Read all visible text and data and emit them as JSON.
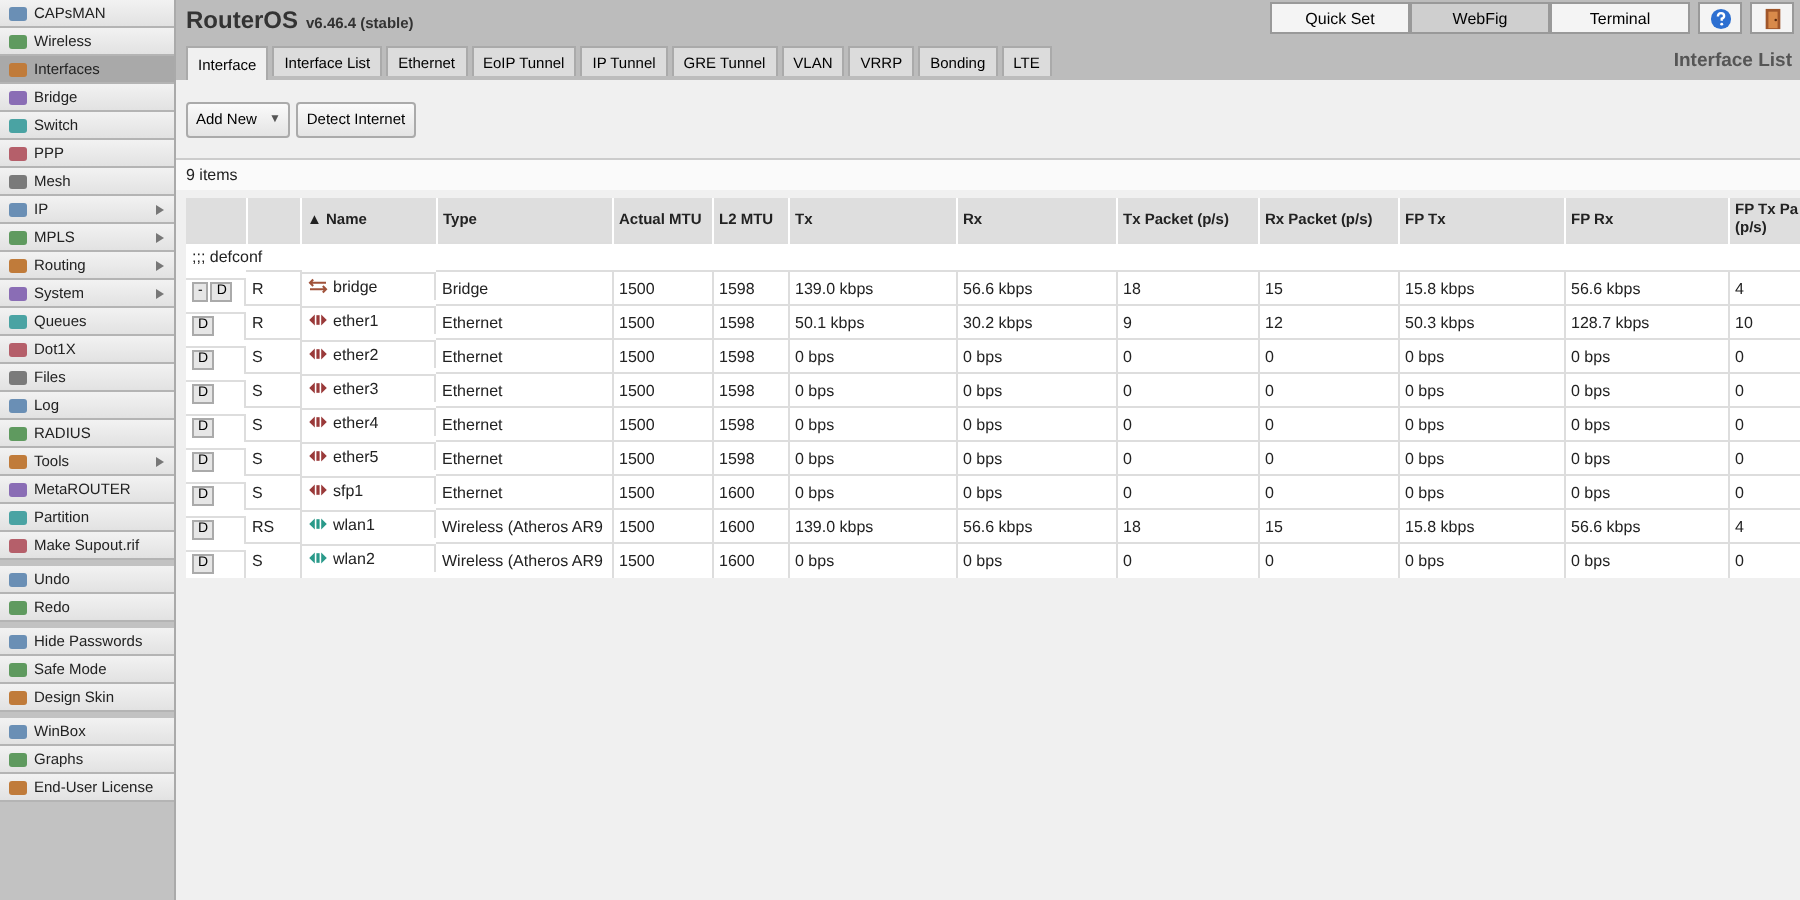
{
  "sidebar": {
    "groups": [
      [
        {
          "label": "CAPsMAN",
          "selected": false,
          "submenu": false
        },
        {
          "label": "Wireless",
          "selected": false,
          "submenu": false
        },
        {
          "label": "Interfaces",
          "selected": true,
          "submenu": false
        },
        {
          "label": "Bridge",
          "selected": false,
          "submenu": false
        },
        {
          "label": "Switch",
          "selected": false,
          "submenu": false
        },
        {
          "label": "PPP",
          "selected": false,
          "submenu": false
        },
        {
          "label": "Mesh",
          "selected": false,
          "submenu": false
        },
        {
          "label": "IP",
          "selected": false,
          "submenu": true
        },
        {
          "label": "MPLS",
          "selected": false,
          "submenu": true
        },
        {
          "label": "Routing",
          "selected": false,
          "submenu": true
        },
        {
          "label": "System",
          "selected": false,
          "submenu": true
        },
        {
          "label": "Queues",
          "selected": false,
          "submenu": false
        },
        {
          "label": "Dot1X",
          "selected": false,
          "submenu": false
        },
        {
          "label": "Files",
          "selected": false,
          "submenu": false
        },
        {
          "label": "Log",
          "selected": false,
          "submenu": false
        },
        {
          "label": "RADIUS",
          "selected": false,
          "submenu": false
        },
        {
          "label": "Tools",
          "selected": false,
          "submenu": true
        },
        {
          "label": "MetaROUTER",
          "selected": false,
          "submenu": false
        },
        {
          "label": "Partition",
          "selected": false,
          "submenu": false
        },
        {
          "label": "Make Supout.rif",
          "selected": false,
          "submenu": false
        }
      ],
      [
        {
          "label": "Undo",
          "selected": false,
          "submenu": false
        },
        {
          "label": "Redo",
          "selected": false,
          "submenu": false
        }
      ],
      [
        {
          "label": "Hide Passwords",
          "selected": false,
          "submenu": false
        },
        {
          "label": "Safe Mode",
          "selected": false,
          "submenu": false
        },
        {
          "label": "Design Skin",
          "selected": false,
          "submenu": false
        }
      ],
      [
        {
          "label": "WinBox",
          "selected": false,
          "submenu": false
        },
        {
          "label": "Graphs",
          "selected": false,
          "submenu": false
        },
        {
          "label": "End-User License",
          "selected": false,
          "submenu": false
        }
      ]
    ]
  },
  "header": {
    "product": "RouterOS",
    "version": "v6.46.4 (stable)",
    "mode_buttons": [
      {
        "label": "Quick Set",
        "selected": false
      },
      {
        "label": "WebFig",
        "selected": true
      },
      {
        "label": "Terminal",
        "selected": false
      }
    ]
  },
  "tabs": [
    {
      "label": "Interface",
      "selected": true
    },
    {
      "label": "Interface List",
      "selected": false
    },
    {
      "label": "Ethernet",
      "selected": false
    },
    {
      "label": "EoIP Tunnel",
      "selected": false
    },
    {
      "label": "IP Tunnel",
      "selected": false
    },
    {
      "label": "GRE Tunnel",
      "selected": false
    },
    {
      "label": "VLAN",
      "selected": false
    },
    {
      "label": "VRRP",
      "selected": false
    },
    {
      "label": "Bonding",
      "selected": false
    },
    {
      "label": "LTE",
      "selected": false
    }
  ],
  "page_title": "Interface List",
  "toolbar": {
    "add_button": "Add New",
    "caret": "▼",
    "detect_button": "Detect Internet"
  },
  "item_count": "9 items",
  "table": {
    "columns": [
      "▲ Name",
      "Type",
      "Actual MTU",
      "L2 MTU",
      "Tx",
      "Rx",
      "Tx Packet (p/s)",
      "Rx Packet (p/s)",
      "FP Tx",
      "FP Rx",
      "FP Tx Pa (p/s)"
    ],
    "comment": ";;; defconf",
    "rows": [
      {
        "flags": [
          "-",
          "D"
        ],
        "status": "R",
        "kind": "bridge",
        "cells": [
          "bridge",
          "Bridge",
          "1500",
          "1598",
          "139.0 kbps",
          "56.6 kbps",
          "18",
          "15",
          "15.8 kbps",
          "56.6 kbps",
          "4"
        ]
      },
      {
        "flags": [
          "D"
        ],
        "status": "R",
        "kind": "ethernet",
        "cells": [
          "ether1",
          "Ethernet",
          "1500",
          "1598",
          "50.1 kbps",
          "30.2 kbps",
          "9",
          "12",
          "50.3 kbps",
          "128.7 kbps",
          "10"
        ]
      },
      {
        "flags": [
          "D"
        ],
        "status": "S",
        "kind": "ethernet",
        "cells": [
          "ether2",
          "Ethernet",
          "1500",
          "1598",
          "0 bps",
          "0 bps",
          "0",
          "0",
          "0 bps",
          "0 bps",
          "0"
        ]
      },
      {
        "flags": [
          "D"
        ],
        "status": "S",
        "kind": "ethernet",
        "cells": [
          "ether3",
          "Ethernet",
          "1500",
          "1598",
          "0 bps",
          "0 bps",
          "0",
          "0",
          "0 bps",
          "0 bps",
          "0"
        ]
      },
      {
        "flags": [
          "D"
        ],
        "status": "S",
        "kind": "ethernet",
        "cells": [
          "ether4",
          "Ethernet",
          "1500",
          "1598",
          "0 bps",
          "0 bps",
          "0",
          "0",
          "0 bps",
          "0 bps",
          "0"
        ]
      },
      {
        "flags": [
          "D"
        ],
        "status": "S",
        "kind": "ethernet",
        "cells": [
          "ether5",
          "Ethernet",
          "1500",
          "1598",
          "0 bps",
          "0 bps",
          "0",
          "0",
          "0 bps",
          "0 bps",
          "0"
        ]
      },
      {
        "flags": [
          "D"
        ],
        "status": "S",
        "kind": "ethernet",
        "cells": [
          "sfp1",
          "Ethernet",
          "1500",
          "1600",
          "0 bps",
          "0 bps",
          "0",
          "0",
          "0 bps",
          "0 bps",
          "0"
        ]
      },
      {
        "flags": [
          "D"
        ],
        "status": "RS",
        "kind": "wireless",
        "cells": [
          "wlan1",
          "Wireless (Atheros AR9",
          "1500",
          "1600",
          "139.0 kbps",
          "56.6 kbps",
          "18",
          "15",
          "15.8 kbps",
          "56.6 kbps",
          "4"
        ]
      },
      {
        "flags": [
          "D"
        ],
        "status": "S",
        "kind": "wireless",
        "cells": [
          "wlan2",
          "Wireless (Atheros AR9",
          "1500",
          "1600",
          "0 bps",
          "0 bps",
          "0",
          "0",
          "0 bps",
          "0 bps",
          "0"
        ]
      }
    ]
  }
}
